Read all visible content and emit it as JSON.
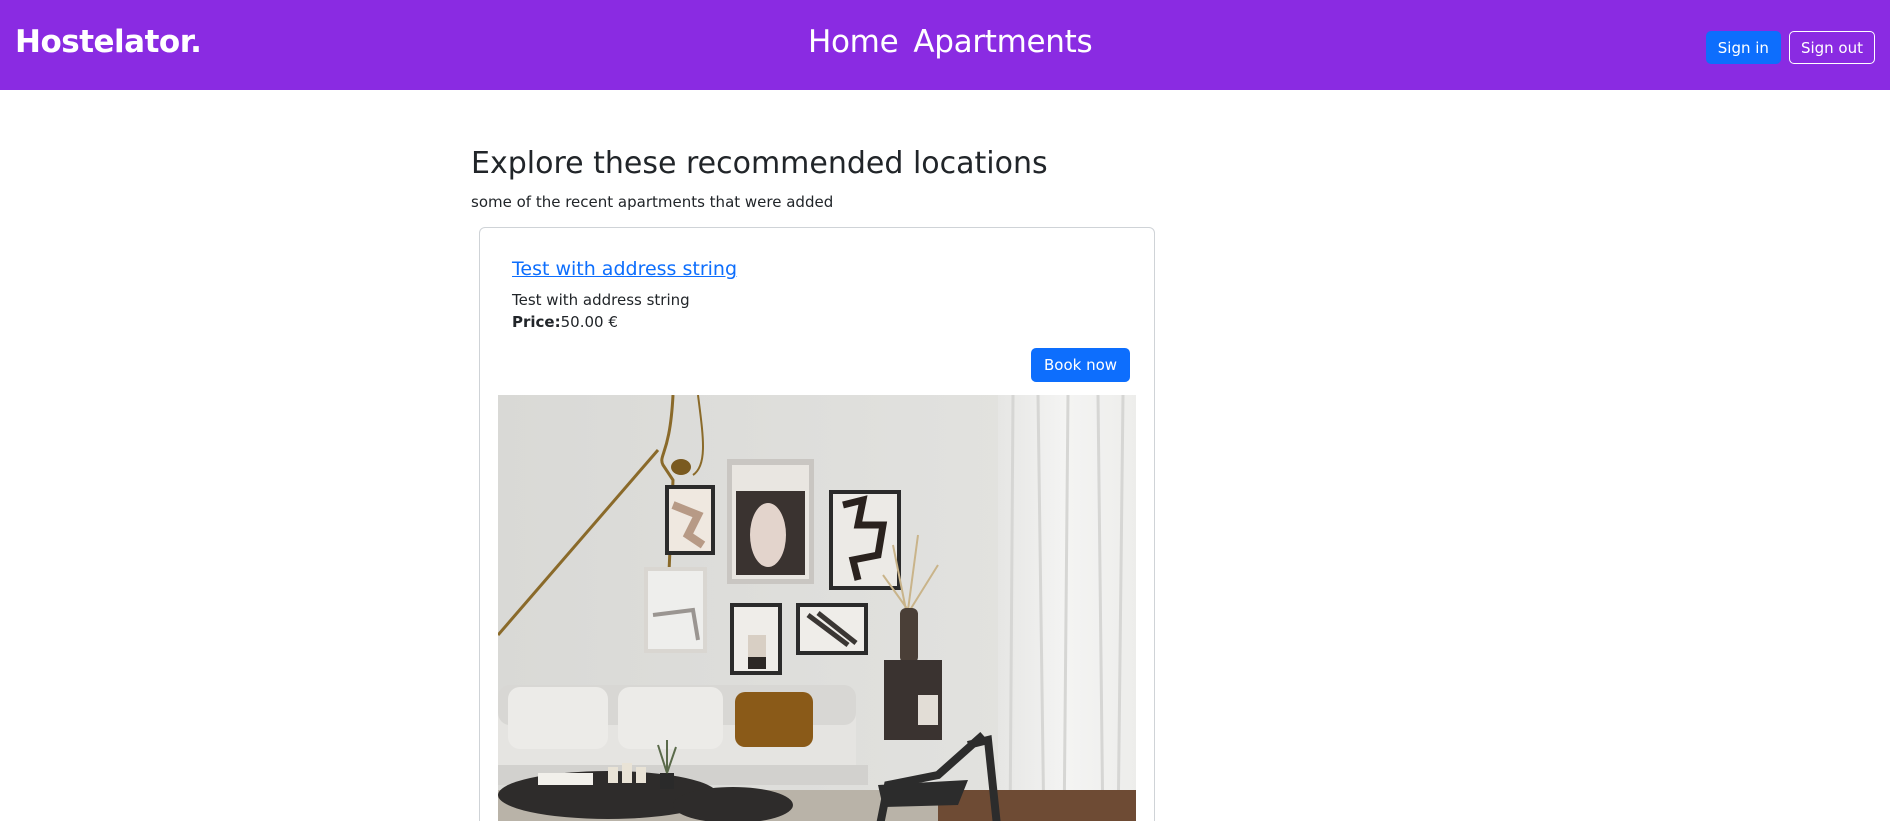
{
  "nav": {
    "brand": "Hostelator.",
    "links": [
      "Home",
      "Apartments"
    ],
    "sign_in": "Sign in",
    "sign_out": "Sign out"
  },
  "main": {
    "heading": "Explore these recommended locations",
    "subheading": "some of the recent apartments that were added"
  },
  "card": {
    "title": "Test with address string",
    "description": "Test with address string",
    "price_label": "Price:",
    "price_value": "50.00 €",
    "book_label": "Book now",
    "image_icon": "living-room-photo"
  },
  "colors": {
    "navbar": "#8a2be2",
    "primary": "#0d6efd",
    "text": "#212529"
  }
}
